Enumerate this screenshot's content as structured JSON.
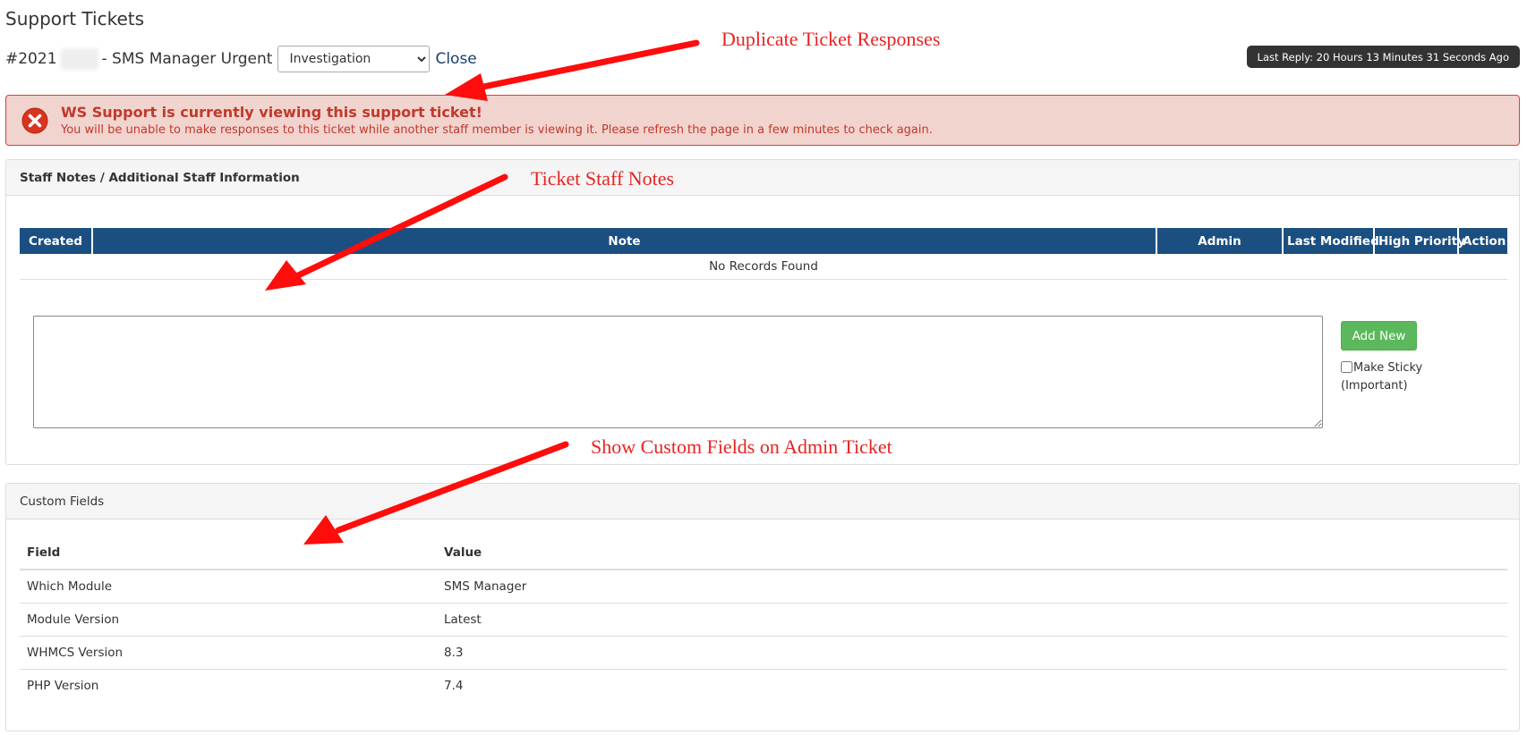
{
  "page": {
    "title": "Support Tickets"
  },
  "ticket": {
    "id": "#2021",
    "subject": "- SMS Manager Urgent",
    "status_selected": "Investigation",
    "close_label": "Close",
    "last_reply": "Last Reply: 20 Hours 13 Minutes 31 Seconds Ago"
  },
  "alert": {
    "title": "WS Support is currently viewing this support ticket!",
    "message": "You will be unable to make responses to this ticket while another staff member is viewing it. Please refresh the page in a few minutes to check again.",
    "icon": "error-x-icon",
    "color": "#c0392b"
  },
  "staff_notes": {
    "heading": "Staff Notes / Additional Staff Information",
    "columns": [
      "Created",
      "Note",
      "Admin",
      "Last Modified",
      "High Priority",
      "Action"
    ],
    "empty_message": "No Records Found",
    "add_button": "Add New",
    "sticky_label": "Make Sticky (Important)",
    "header_color": "#1b4f82",
    "button_color": "#5cb85c"
  },
  "custom_fields": {
    "heading": "Custom Fields",
    "columns": [
      "Field",
      "Value"
    ],
    "rows": [
      {
        "field": "Which Module",
        "value": "SMS Manager"
      },
      {
        "field": "Module Version",
        "value": "Latest"
      },
      {
        "field": "WHMCS Version",
        "value": "8.3"
      },
      {
        "field": "PHP Version",
        "value": "7.4"
      }
    ]
  },
  "annotations": {
    "duplicate": "Duplicate Ticket Responses",
    "staff_notes": "Ticket Staff Notes",
    "custom_fields": "Show Custom Fields on Admin Ticket",
    "color": "#e82323"
  }
}
